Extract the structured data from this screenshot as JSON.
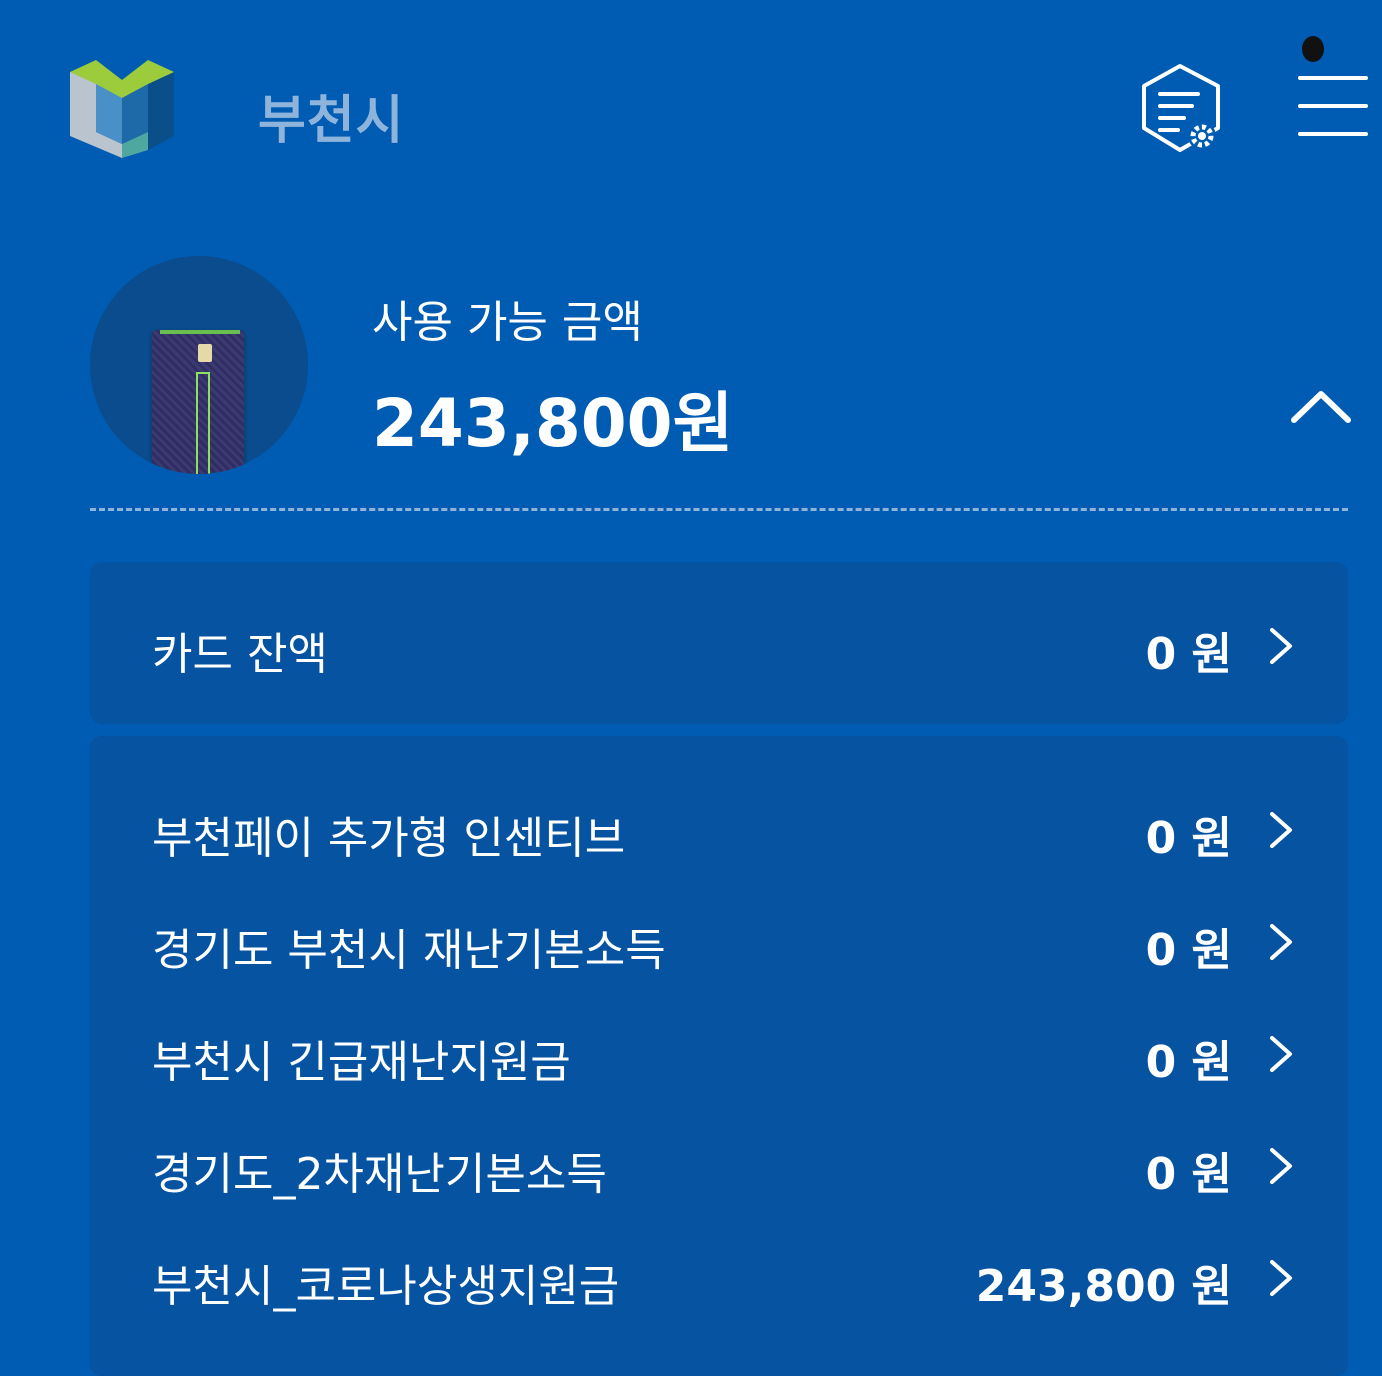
{
  "header": {
    "city_name": "부천시",
    "logo_icon": "city-logo-icon",
    "settings_icon": "settings-document-icon",
    "menu_icon": "hamburger-menu-icon"
  },
  "summary": {
    "available_label": "사용 가능 금액",
    "available_amount": "243,800원",
    "card_image": "card-image",
    "collapse_icon": "chevron-up-icon"
  },
  "balance_rows": [
    {
      "label": "카드 잔액",
      "value": "0 원"
    }
  ],
  "support_rows": [
    {
      "label": "부천페이 추가형 인센티브",
      "value": "0 원"
    },
    {
      "label": "경기도 부천시 재난기본소득",
      "value": "0 원"
    },
    {
      "label": "부천시 긴급재난지원금",
      "value": "0 원"
    },
    {
      "label": "경기도_2차재난기본소득",
      "value": "0 원"
    },
    {
      "label": "부천시_코로나상생지원금",
      "value": "243,800 원"
    }
  ],
  "colors": {
    "background": "#005cb3",
    "panel": "#0553a1",
    "muted_text": "#8fb4db"
  }
}
